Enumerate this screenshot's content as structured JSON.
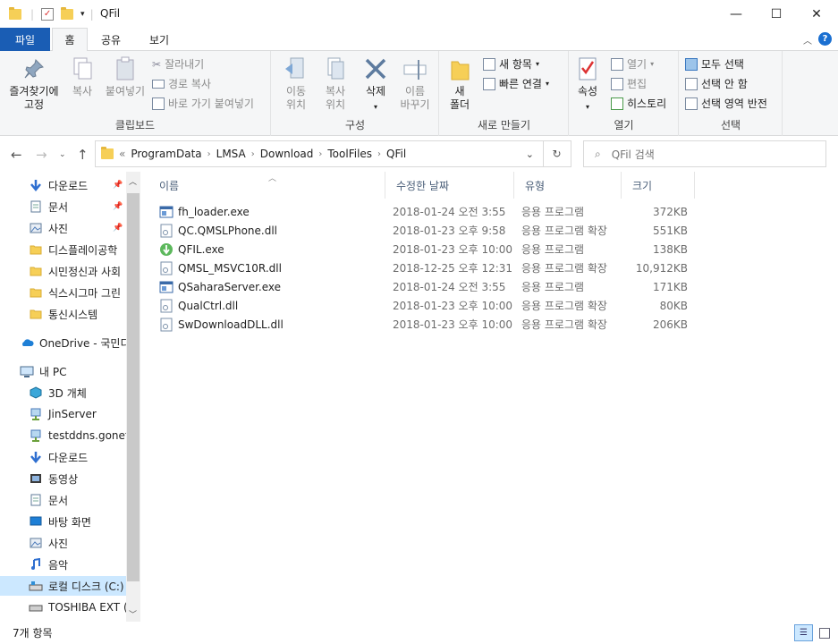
{
  "window": {
    "title": "QFil"
  },
  "tabs": {
    "file": "파일",
    "home": "홈",
    "share": "공유",
    "view": "보기"
  },
  "ribbon": {
    "clipboard": {
      "pin": "즐겨찾기에\n고정",
      "copy": "복사",
      "paste": "붙여넣기",
      "cut": "잘라내기",
      "copy_path": "경로 복사",
      "paste_shortcut": "바로 가기 붙여넣기",
      "label": "클립보드"
    },
    "organize": {
      "move_to": "이동\n위치",
      "copy_to": "복사\n위치",
      "delete": "삭제",
      "rename": "이름\n바꾸기",
      "label": "구성"
    },
    "new": {
      "new_folder": "새\n폴더",
      "new_item": "새 항목",
      "easy_access": "빠른 연결",
      "label": "새로 만들기"
    },
    "open": {
      "properties": "속성",
      "open": "열기",
      "edit": "편집",
      "history": "히스토리",
      "label": "열기"
    },
    "select": {
      "select_all": "모두 선택",
      "select_none": "선택 안 함",
      "invert": "선택 영역 반전",
      "label": "선택"
    }
  },
  "address": {
    "prefix": "«",
    "crumbs": [
      "ProgramData",
      "LMSA",
      "Download",
      "ToolFiles",
      "QFil"
    ]
  },
  "search": {
    "placeholder": "QFil 검색"
  },
  "nav": [
    {
      "label": "다운로드",
      "icon": "download-icon",
      "pinned": true
    },
    {
      "label": "문서",
      "icon": "document-icon",
      "pinned": true
    },
    {
      "label": "사진",
      "icon": "picture-icon",
      "pinned": true
    },
    {
      "label": "디스플레이공학",
      "icon": "folder-icon"
    },
    {
      "label": "시민정신과 사회",
      "icon": "folder-icon"
    },
    {
      "label": "식스시그마 그린",
      "icon": "folder-icon"
    },
    {
      "label": "통신시스템",
      "icon": "folder-icon"
    },
    {
      "label": "OneDrive - 국민디",
      "icon": "cloud-icon"
    },
    {
      "label": "내 PC",
      "icon": "pc-icon"
    },
    {
      "label": "3D 개체",
      "icon": "cube-icon"
    },
    {
      "label": "JinServer",
      "icon": "network-drive-icon"
    },
    {
      "label": "testddns.gonetis",
      "icon": "network-drive-icon"
    },
    {
      "label": "다운로드",
      "icon": "download-icon"
    },
    {
      "label": "동영상",
      "icon": "video-icon"
    },
    {
      "label": "문서",
      "icon": "document-icon"
    },
    {
      "label": "바탕 화면",
      "icon": "desktop-icon"
    },
    {
      "label": "사진",
      "icon": "picture-icon"
    },
    {
      "label": "음악",
      "icon": "music-icon"
    },
    {
      "label": "로컬 디스크 (C:)",
      "icon": "disk-icon",
      "selected": true
    },
    {
      "label": "TOSHIBA EXT (D",
      "icon": "usb-drive-icon"
    }
  ],
  "columns": {
    "name": "이름",
    "date": "수정한 날짜",
    "type": "유형",
    "size": "크기"
  },
  "files": [
    {
      "name": "fh_loader.exe",
      "date": "2018-01-24 오전 3:55",
      "type": "응용 프로그램",
      "size": "372KB",
      "icon": "exe-icon"
    },
    {
      "name": "QC.QMSLPhone.dll",
      "date": "2018-01-23 오후 9:58",
      "type": "응용 프로그램 확장",
      "size": "551KB",
      "icon": "dll-icon"
    },
    {
      "name": "QFIL.exe",
      "date": "2018-01-23 오후 10:00",
      "type": "응용 프로그램",
      "size": "138KB",
      "icon": "qfil-download-icon"
    },
    {
      "name": "QMSL_MSVC10R.dll",
      "date": "2018-12-25 오후 12:31",
      "type": "응용 프로그램 확장",
      "size": "10,912KB",
      "icon": "dll-icon"
    },
    {
      "name": "QSaharaServer.exe",
      "date": "2018-01-24 오전 3:55",
      "type": "응용 프로그램",
      "size": "171KB",
      "icon": "exe-icon"
    },
    {
      "name": "QualCtrl.dll",
      "date": "2018-01-23 오후 10:00",
      "type": "응용 프로그램 확장",
      "size": "80KB",
      "icon": "dll-icon"
    },
    {
      "name": "SwDownloadDLL.dll",
      "date": "2018-01-23 오후 10:00",
      "type": "응용 프로그램 확장",
      "size": "206KB",
      "icon": "dll-icon"
    }
  ],
  "status": {
    "count": "7개 항목"
  },
  "colors": {
    "accent": "#1a5db4",
    "selection": "#cce8ff",
    "folder": "#f6cf57"
  }
}
